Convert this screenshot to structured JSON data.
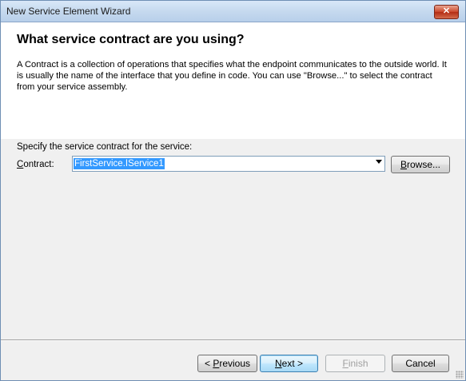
{
  "window": {
    "title": "New Service Element Wizard",
    "close_glyph": "✕"
  },
  "header": {
    "heading": "What service contract are you using?",
    "description": "A Contract is a collection of operations that specifies what the endpoint communicates to the outside world. It is usually the name of the interface that you define in code. You can use \"Browse...\" to select the contract from your service assembly."
  },
  "form": {
    "specify_label": "Specify the service contract for the service:",
    "contract_label_mnemonic": "C",
    "contract_label_rest": "ontract:",
    "contract_value": "FirstService.IService1",
    "browse_mnemonic": "B",
    "browse_rest": "rowse..."
  },
  "buttons": {
    "previous_prefix": "< ",
    "previous_mnemonic": "P",
    "previous_rest": "revious",
    "next_mnemonic": "N",
    "next_rest": "ext >",
    "finish_mnemonic": "F",
    "finish_rest": "inish",
    "cancel": "Cancel"
  },
  "icons": {
    "close": "close-icon",
    "dropdown": "chevron-down-icon",
    "grip": "resize-grip-icon"
  }
}
